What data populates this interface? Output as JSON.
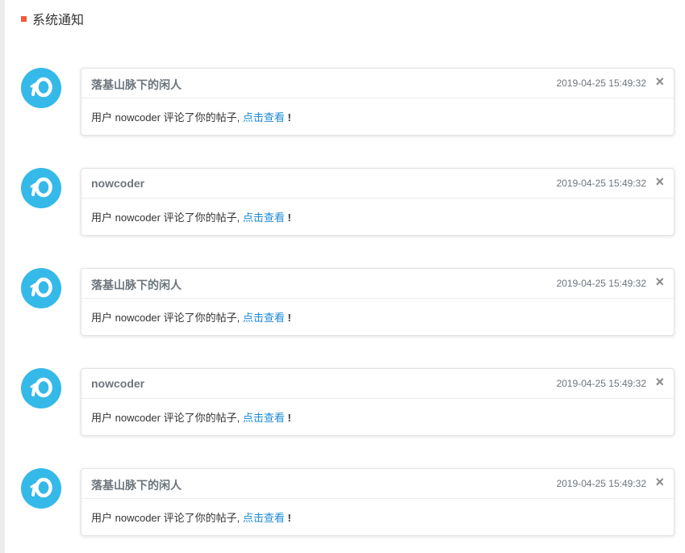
{
  "header": {
    "title": "系统通知",
    "marker_color": "#f15a3a"
  },
  "avatar_icon": "nowcoder-logo-icon",
  "notices": [
    {
      "author": "落基山脉下的闲人",
      "time": "2019-04-25 15:49:32",
      "message": "用户 nowcoder 评论了你的帖子, ",
      "link_text": "点击查看",
      "suffix": "!",
      "close": "×"
    },
    {
      "author": "nowcoder",
      "time": "2019-04-25 15:49:32",
      "message": "用户 nowcoder 评论了你的帖子, ",
      "link_text": "点击查看",
      "suffix": "!",
      "close": "×"
    },
    {
      "author": "落基山脉下的闲人",
      "time": "2019-04-25 15:49:32",
      "message": "用户 nowcoder 评论了你的帖子, ",
      "link_text": "点击查看",
      "suffix": "!",
      "close": "×"
    },
    {
      "author": "nowcoder",
      "time": "2019-04-25 15:49:32",
      "message": "用户 nowcoder 评论了你的帖子, ",
      "link_text": "点击查看",
      "suffix": "!",
      "close": "×"
    },
    {
      "author": "落基山脉下的闲人",
      "time": "2019-04-25 15:49:32",
      "message": "用户 nowcoder 评论了你的帖子, ",
      "link_text": "点击查看",
      "suffix": "!",
      "close": "×"
    }
  ]
}
